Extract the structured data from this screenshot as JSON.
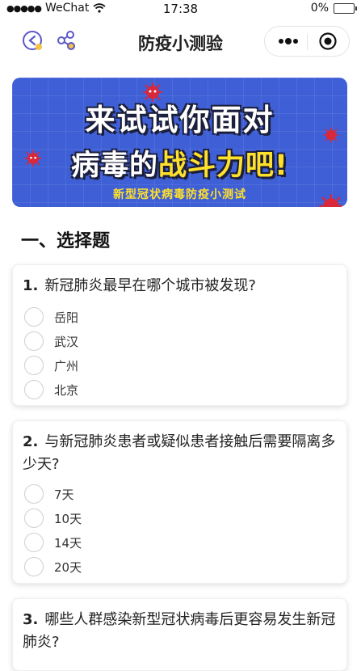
{
  "status_bar": {
    "carrier": "WeChat",
    "time": "17:38",
    "battery": "0%"
  },
  "nav": {
    "title": "防疫小测验",
    "icons": [
      "back-icon",
      "share-icon",
      "more-icon",
      "close-icon"
    ]
  },
  "banner": {
    "line1": "来试试你面对",
    "line2_white": "病毒的",
    "line2_yellow": "战斗力吧!",
    "subtitle": "新型冠状病毒防疫小测试"
  },
  "section": {
    "title": "一、选择题"
  },
  "questions": [
    {
      "number": "1.",
      "text": "新冠肺炎最早在哪个城市被发现?",
      "options": [
        "岳阳",
        "武汉",
        "广州",
        "北京"
      ]
    },
    {
      "number": "2.",
      "text": "与新冠肺炎患者或疑似患者接触后需要隔离多少天?",
      "options": [
        "7天",
        "10天",
        "14天",
        "20天"
      ]
    },
    {
      "number": "3.",
      "text": "哪些人群感染新型冠状病毒后更容易发生新冠肺炎?",
      "options": []
    }
  ],
  "colors": {
    "banner_blue": "#3f5fd6",
    "banner_yellow": "#ffe02b",
    "virus_red": "#d8283a",
    "accent_purple": "#5b57c9"
  }
}
